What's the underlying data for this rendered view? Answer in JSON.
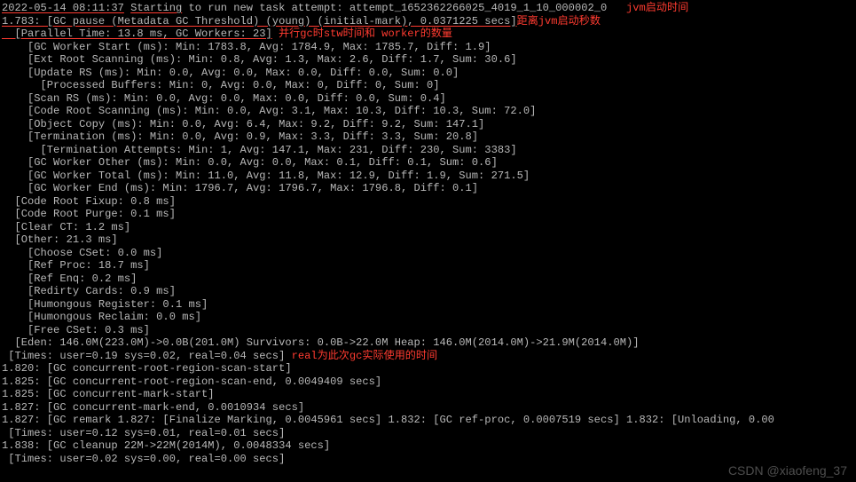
{
  "ts": "2022-05-14 08:11:37",
  "starting": "Starting",
  "startTail": " to run new task attempt: attempt_1652362266025_4019_1_10_000002_0",
  "noteJvmStart": "jvm启动时间",
  "l2a": "1.783: [GC pause (Metadata GC Threshold) (young) (initial-mark), 0.0371225 secs]",
  "noteSinceJvm": "距离jvm启动秒数",
  "l3a": "  [Parallel Time: 13.8 ms, GC Workers: 23]",
  "noteParallel": "并行gc时stw时间和 worker的数量",
  "l4": "    [GC Worker Start (ms): Min: 1783.8, Avg: 1784.9, Max: 1785.7, Diff: 1.9]",
  "l5": "    [Ext Root Scanning (ms): Min: 0.8, Avg: 1.3, Max: 2.6, Diff: 1.7, Sum: 30.6]",
  "l6": "    [Update RS (ms): Min: 0.0, Avg: 0.0, Max: 0.0, Diff: 0.0, Sum: 0.0]",
  "l7": "      [Processed Buffers: Min: 0, Avg: 0.0, Max: 0, Diff: 0, Sum: 0]",
  "l8": "    [Scan RS (ms): Min: 0.0, Avg: 0.0, Max: 0.0, Diff: 0.0, Sum: 0.4]",
  "l9": "    [Code Root Scanning (ms): Min: 0.0, Avg: 3.1, Max: 10.3, Diff: 10.3, Sum: 72.0]",
  "l10": "    [Object Copy (ms): Min: 0.0, Avg: 6.4, Max: 9.2, Diff: 9.2, Sum: 147.1]",
  "l11": "    [Termination (ms): Min: 0.0, Avg: 0.9, Max: 3.3, Diff: 3.3, Sum: 20.8]",
  "l12": "      [Termination Attempts: Min: 1, Avg: 147.1, Max: 231, Diff: 230, Sum: 3383]",
  "l13": "    [GC Worker Other (ms): Min: 0.0, Avg: 0.0, Max: 0.1, Diff: 0.1, Sum: 0.6]",
  "l14": "    [GC Worker Total (ms): Min: 11.0, Avg: 11.8, Max: 12.9, Diff: 1.9, Sum: 271.5]",
  "l15": "    [GC Worker End (ms): Min: 1796.7, Avg: 1796.7, Max: 1796.8, Diff: 0.1]",
  "l16": "  [Code Root Fixup: 0.8 ms]",
  "l17": "  [Code Root Purge: 0.1 ms]",
  "l18": "  [Clear CT: 1.2 ms]",
  "l19": "  [Other: 21.3 ms]",
  "l20": "    [Choose CSet: 0.0 ms]",
  "l21": "    [Ref Proc: 18.7 ms]",
  "l22": "    [Ref Enq: 0.2 ms]",
  "l23": "    [Redirty Cards: 0.9 ms]",
  "l24": "    [Humongous Register: 0.1 ms]",
  "l25": "    [Humongous Reclaim: 0.0 ms]",
  "l26": "    [Free CSet: 0.3 ms]",
  "l27": "  [Eden: 146.0M(223.0M)->0.0B(201.0M) Survivors: 0.0B->22.0M Heap: 146.0M(2014.0M)->21.9M(2014.0M)]",
  "l28a": " [Times: user=0.19 sys=0.02, real=0.04 secs] ",
  "noteReal": "real为此次gc实际使用的时间",
  "l29": "1.820: [GC concurrent-root-region-scan-start]",
  "l30": "1.825: [GC concurrent-root-region-scan-end, 0.0049409 secs]",
  "l31": "1.825: [GC concurrent-mark-start]",
  "l32": "1.827: [GC concurrent-mark-end, 0.0010934 secs]",
  "l33": "1.827: [GC remark 1.827: [Finalize Marking, 0.0045961 secs] 1.832: [GC ref-proc, 0.0007519 secs] 1.832: [Unloading, 0.00",
  "l34": " [Times: user=0.12 sys=0.01, real=0.01 secs]",
  "l35": "1.838: [GC cleanup 22M->22M(2014M), 0.0048334 secs]",
  "l36": " [Times: user=0.02 sys=0.00, real=0.00 secs]",
  "watermark": "CSDN @xiaofeng_37"
}
